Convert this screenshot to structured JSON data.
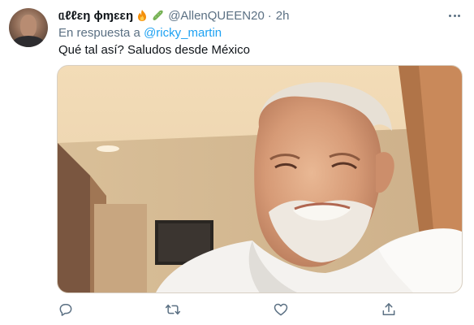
{
  "tweet": {
    "display_name": "ᥲℓℓɛŋ ɸɱɛɛŋ",
    "handle": "@AllenQUEEN20",
    "separator": "·",
    "time": "2h",
    "reply_prefix": "En respuesta a",
    "reply_to": "@ricky_martin",
    "text": "Qué tal así? Saludos desde México"
  },
  "icons": {
    "avatar": "avatar",
    "fire": "fire-emoji",
    "cucumber": "cucumber-emoji",
    "more": "more-icon",
    "reply": "reply-icon",
    "retweet": "retweet-icon",
    "like": "like-icon",
    "share": "share-icon"
  },
  "colors": {
    "link": "#1da1f2",
    "secondary": "#5b7083",
    "text": "#0f1419"
  }
}
